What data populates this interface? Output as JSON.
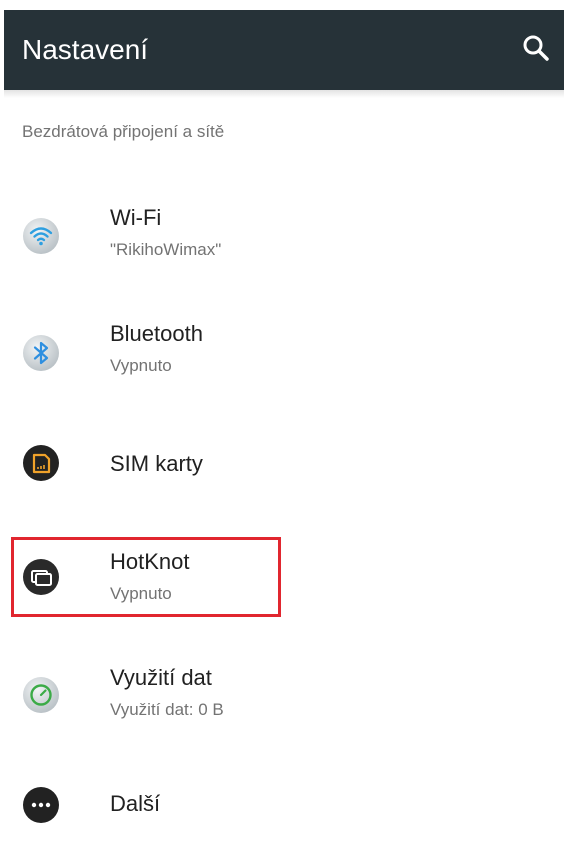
{
  "toolbar": {
    "title": "Nastavení",
    "search_icon": "search-icon",
    "background": "#263238"
  },
  "section": {
    "header": "Bezdrátová připojení a sítě"
  },
  "items": [
    {
      "title": "Wi-Fi",
      "summary": "\"RikihoWimax\"",
      "icon": "wifi-icon"
    },
    {
      "title": "Bluetooth",
      "summary": "Vypnuto",
      "icon": "bluetooth-icon"
    },
    {
      "title": "SIM karty",
      "summary": "",
      "icon": "sim-card-icon"
    },
    {
      "title": "HotKnot",
      "summary": "Vypnuto",
      "icon": "hotknot-icon"
    },
    {
      "title": "Využití dat",
      "summary": "Využití dat: 0 B",
      "icon": "data-usage-icon"
    },
    {
      "title": "Další",
      "summary": "",
      "icon": "more-icon"
    }
  ],
  "highlight": {
    "color": "#e1262f",
    "target": "HotKnot"
  }
}
